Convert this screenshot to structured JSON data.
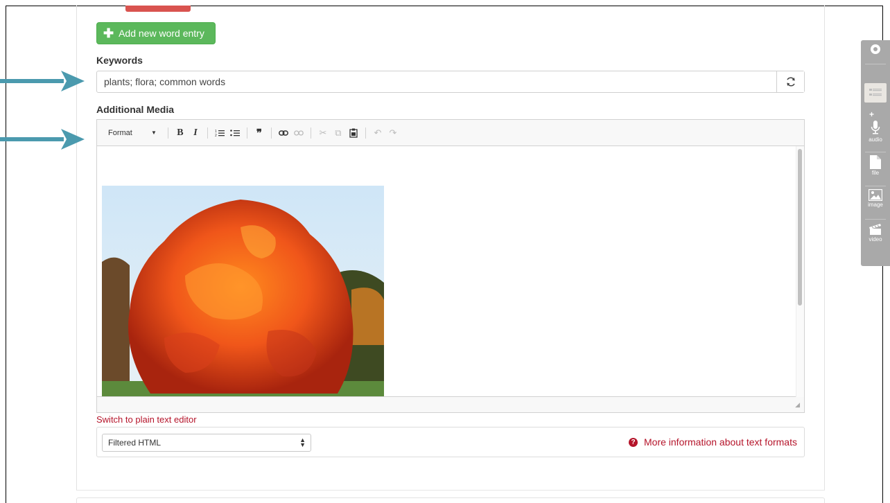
{
  "actions": {
    "add_word_entry": "Add new word entry"
  },
  "keywords": {
    "label": "Keywords",
    "value": "plants; flora; common words"
  },
  "media": {
    "label": "Additional Media",
    "toolbar": {
      "format_label": "Format"
    }
  },
  "editor_links": {
    "switch_editor": "Switch to plain text editor",
    "format_select_value": "Filtered HTML",
    "more_info": "More information about text formats"
  },
  "media_sidebar": {
    "audio": "audio",
    "file": "file",
    "image": "image",
    "video": "video"
  },
  "colors": {
    "success": "#5cb85c",
    "danger": "#d9534f",
    "link": "#b5142a",
    "arrow": "#4b9aae",
    "sidebar": "#a9a9a9"
  }
}
